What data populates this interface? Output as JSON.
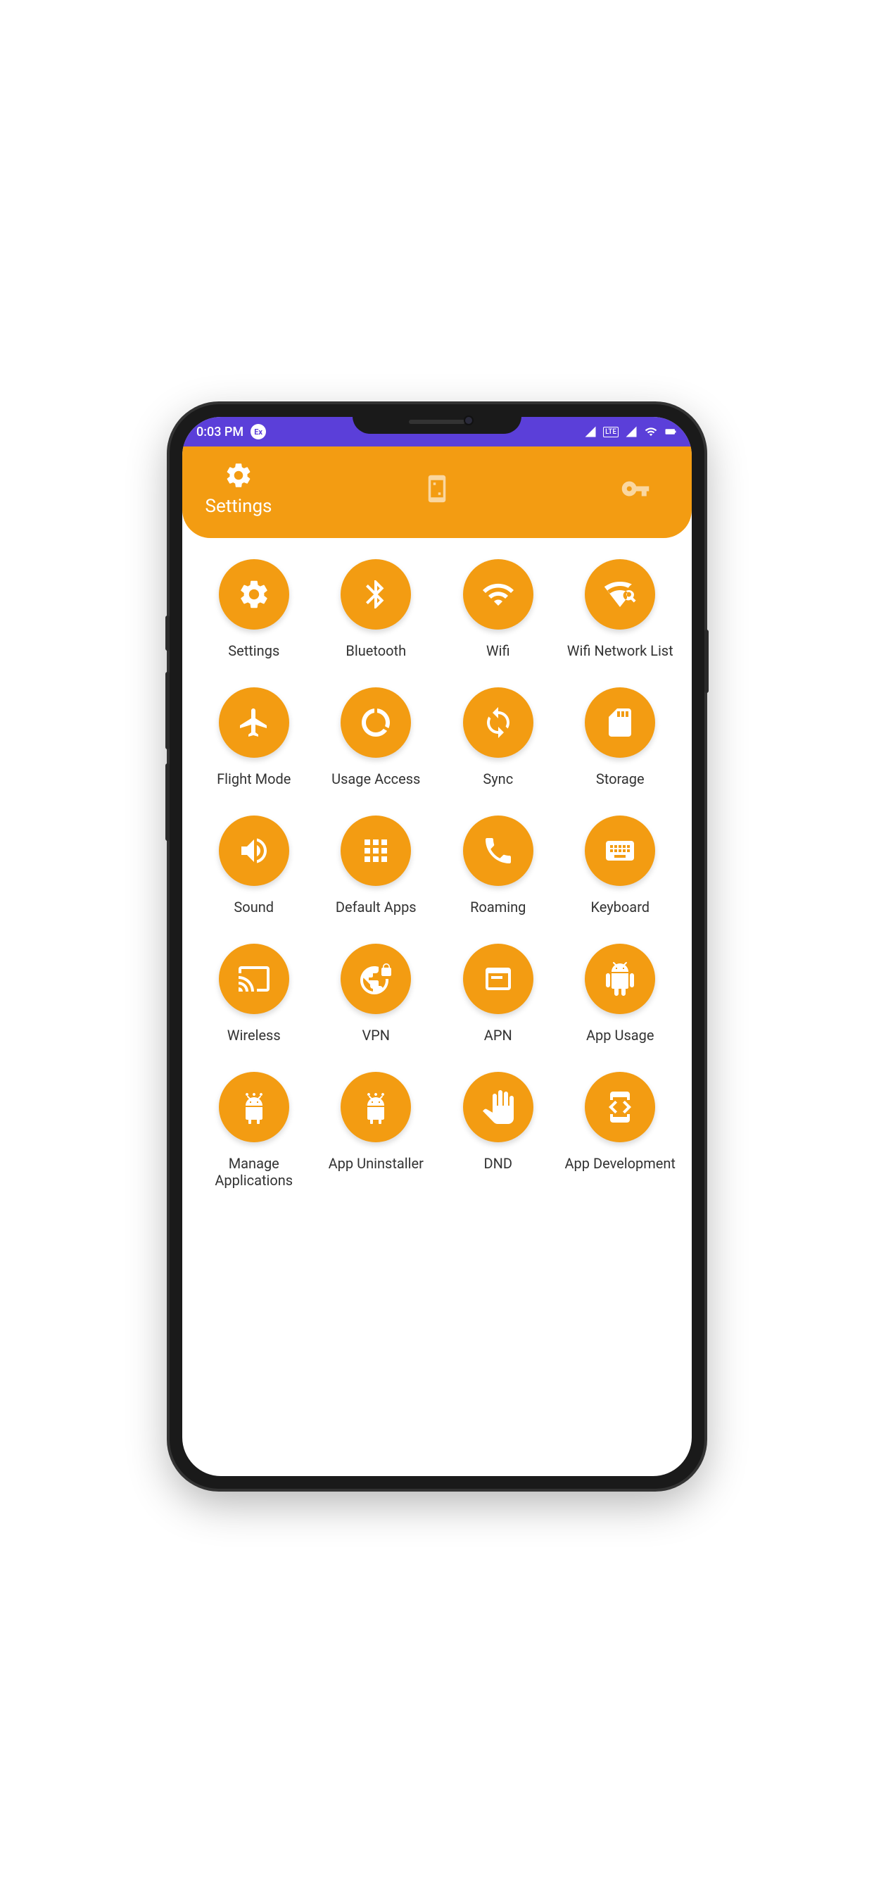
{
  "status_bar": {
    "time": "0:03 PM",
    "badge": "Ex"
  },
  "header": {
    "tabs": [
      {
        "label": "Settings",
        "icon": "gear",
        "active": true
      },
      {
        "label": "",
        "icon": "phone-frame",
        "active": false
      },
      {
        "label": "",
        "icon": "key",
        "active": false
      }
    ]
  },
  "grid": [
    {
      "label": "Settings",
      "icon": "gear"
    },
    {
      "label": "Bluetooth",
      "icon": "bluetooth"
    },
    {
      "label": "Wifi",
      "icon": "wifi"
    },
    {
      "label": "Wifi Network List",
      "icon": "wifi-search"
    },
    {
      "label": "Flight Mode",
      "icon": "airplane"
    },
    {
      "label": "Usage Access",
      "icon": "data-usage"
    },
    {
      "label": "Sync",
      "icon": "sync"
    },
    {
      "label": "Storage",
      "icon": "sd-card"
    },
    {
      "label": "Sound",
      "icon": "volume"
    },
    {
      "label": "Default Apps",
      "icon": "apps-grid"
    },
    {
      "label": "Roaming",
      "icon": "phone-call"
    },
    {
      "label": "Keyboard",
      "icon": "keyboard"
    },
    {
      "label": "Wireless",
      "icon": "cast"
    },
    {
      "label": "VPN",
      "icon": "vpn-globe"
    },
    {
      "label": "APN",
      "icon": "web-panel"
    },
    {
      "label": "App Usage",
      "icon": "android"
    },
    {
      "label": "Manage Applications",
      "icon": "android-dots"
    },
    {
      "label": "App Uninstaller",
      "icon": "android-dots"
    },
    {
      "label": "DND",
      "icon": "hand"
    },
    {
      "label": "App Development",
      "icon": "dev-mode"
    }
  ]
}
